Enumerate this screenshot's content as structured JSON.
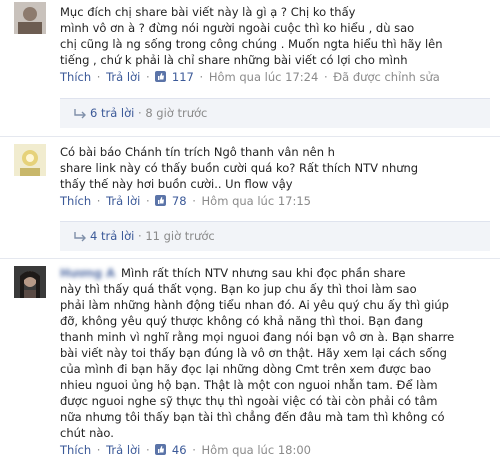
{
  "comments": [
    {
      "lines": [
        "Mục đích chị share bài viết này là gì ạ ? Chị ko thấy",
        "mình vô ơn à ? đừng nói người ngoài cuộc thì ko hiểu , dù sao",
        "chị cũng là ng sống trong công chúng . Muốn ngta hiểu thì hãy lên",
        "tiếng , chứ k phải là chỉ share những bài viết có lợi cho mình"
      ],
      "like_label": "Thích",
      "reply_label": "Trả lời",
      "likes": "117",
      "time": "Hôm qua lúc 17:24",
      "edited": "Đã được chỉnh sửa",
      "replies_count": "6 trả lời",
      "replies_time": "8 giờ trước"
    },
    {
      "lines": [
        "Có bài báo Chánh tín trích Ngô thanh vân nên h",
        "share link này có thấy buồn cười quá ko? Rất thích NTV nhưng",
        "thấy thế này hơi buồn cười.. Un flow vậy"
      ],
      "like_label": "Thích",
      "reply_label": "Trả lời",
      "likes": "78",
      "time": "Hôm qua lúc 17:15",
      "replies_count": "4 trả lời",
      "replies_time": "11 giờ trước"
    },
    {
      "author": "Hương A",
      "lines": [
        "Mình rất thích NTV nhưng sau khi đọc phần share",
        "này thì thấy quá thất vọng. Bạn ko jup chu ấy thì thoi làm sao",
        "phải làm những hành động tiểu nhan đó. Ai yêu quý chu ấy thì giúp",
        "đỡ, không yêu quý thược không có khả năng thì thoi. Bạn đang",
        "thanh minh vì nghĩ rằng mọi nguoi đang nói bạn vô ơn à. Bạn sharre",
        "bài viết này toi thấy bạn đúng là vô ơn thật. Hãy xem lại cách sống",
        "của mình đi bạn hãy đọc lại những dòng Cmt trên xem được bao",
        "nhieu nguoi ủng hộ bạn. Thật là một con nguoi nhẫn tam. Để làm",
        "được nguoi nghe sỹ thực thụ thì ngoài việc có tài còn phải có tâm",
        "nữa nhưng tôi thấy bạn tài thì chẳng đến đâu mà tam thì không có",
        "chút nào."
      ],
      "like_label": "Thích",
      "reply_label": "Trả lời",
      "likes": "46",
      "time": "Hôm qua lúc 18:00"
    }
  ],
  "colors": {
    "link": "#3b5998",
    "meta_gray": "#8a8a8a",
    "replies_bg": "#f2f4f8"
  }
}
